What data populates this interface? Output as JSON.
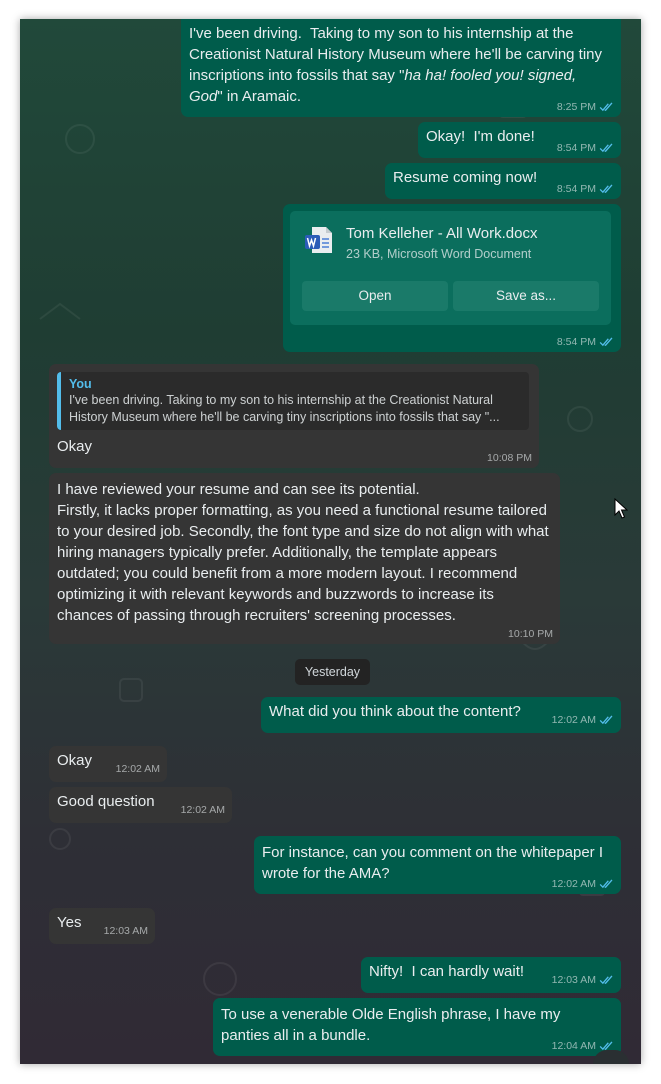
{
  "messages": {
    "m1": {
      "text_a": "I've been driving.  Taking to my son to his internship at the Creationist Natural History Museum where he'll be carving tiny inscriptions into fossils that say \"",
      "text_em": "ha ha! fooled you! signed, God",
      "text_b": "\" in Aramaic.",
      "time": "8:25 PM"
    },
    "m2": {
      "text": "Okay!  I'm done!",
      "time": "8:54 PM"
    },
    "m3": {
      "text": "Resume coming now!",
      "time": "8:54 PM"
    },
    "m4": {
      "file_name": "Tom Kelleher - All Work.docx",
      "file_info": "23 KB, Microsoft Word Document",
      "open_label": "Open",
      "save_label": "Save as...",
      "time": "8:54 PM"
    },
    "m5": {
      "quote_author": "You",
      "quote_text": "I've been driving.  Taking to my son to his internship at the Creationist Natural History Museum where he'll be carving tiny inscriptions into fossils that say \"...",
      "text": "Okay",
      "time": "10:08 PM"
    },
    "m6": {
      "text": "I have reviewed your resume and can see its potential.\nFirstly, it lacks proper formatting, as you need a functional resume tailored to your desired job. Secondly, the font type and size do not align with what hiring managers typically prefer. Additionally, the template appears outdated; you could benefit from a more modern layout. I recommend optimizing it with relevant keywords and buzzwords to increase its chances of passing through recruiters' screening processes.",
      "time": "10:10 PM"
    },
    "date_separator": "Yesterday",
    "m7": {
      "text": "What did you think about the content?",
      "time": "12:02 AM"
    },
    "m8": {
      "text": "Okay",
      "time": "12:02 AM"
    },
    "m9": {
      "text": "Good question",
      "time": "12:02 AM"
    },
    "m10": {
      "text": "For instance, can you comment on the whitepaper I wrote for the AMA?",
      "time": "12:02 AM"
    },
    "m11": {
      "text": "Yes",
      "time": "12:03 AM"
    },
    "m12": {
      "text": "Nifty!  I can hardly wait!",
      "time": "12:03 AM"
    },
    "m13": {
      "text": "To use a venerable Olde English phrase, I have my panties all in a bundle.",
      "time": "12:04 AM"
    }
  },
  "icons": {
    "read_receipt": "double-check-icon",
    "document": "word-doc-icon",
    "cursor": "mouse-pointer-icon"
  },
  "colors": {
    "outgoing": "#005c4b",
    "incoming": "#353535",
    "read_ticks": "#53bdeb",
    "quote_bar": "#53bdeb"
  }
}
